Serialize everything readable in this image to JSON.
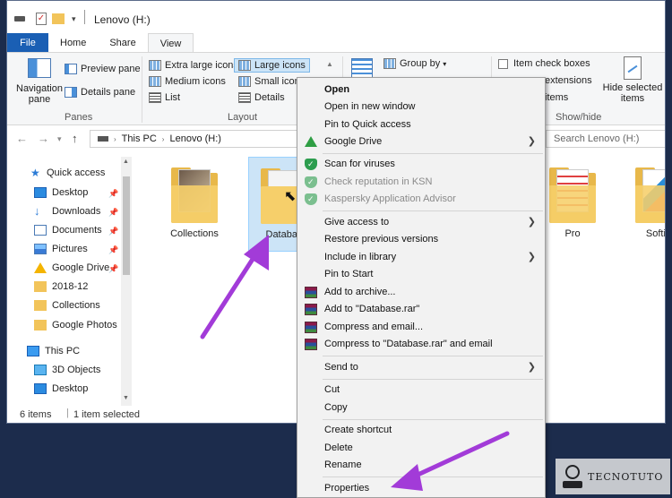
{
  "window": {
    "title": "Lenovo (H:)"
  },
  "ribbon": {
    "tabs": [
      "File",
      "Home",
      "Share",
      "View"
    ],
    "active_tab": "View",
    "panes": {
      "navigation_pane": "Navigation pane",
      "preview_pane": "Preview pane",
      "details_pane": "Details pane",
      "group_label": "Panes"
    },
    "layout": {
      "extra_large": "Extra large icons",
      "large": "Large icons",
      "medium": "Medium icons",
      "small": "Small icons",
      "list": "List",
      "details": "Details",
      "group_label": "Layout"
    },
    "current_view": {
      "group_by": "Group by"
    },
    "show_hide": {
      "item_check_boxes": "Item check boxes",
      "extensions": "extensions",
      "items": "items",
      "hide_selected": "Hide selected items",
      "group_label": "Show/hide"
    }
  },
  "address": {
    "path": [
      "This PC",
      "Lenovo (H:)"
    ],
    "search_placeholder": "Search Lenovo (H:)"
  },
  "nav_pane": {
    "items": [
      {
        "label": "Quick access",
        "icon": "star-icon",
        "pinned": false
      },
      {
        "label": "Desktop",
        "icon": "desktop-icon",
        "pinned": true
      },
      {
        "label": "Downloads",
        "icon": "download-icon",
        "pinned": true
      },
      {
        "label": "Documents",
        "icon": "documents-icon",
        "pinned": true
      },
      {
        "label": "Pictures",
        "icon": "pictures-icon",
        "pinned": true
      },
      {
        "label": "Google Drive",
        "icon": "google-drive-icon",
        "pinned": true
      },
      {
        "label": "2018-12",
        "icon": "folder-icon",
        "pinned": false
      },
      {
        "label": "Collections",
        "icon": "folder-icon",
        "pinned": false
      },
      {
        "label": "Google Photos",
        "icon": "folder-icon",
        "pinned": false
      },
      {
        "label": "This PC",
        "icon": "computer-icon",
        "pinned": false
      },
      {
        "label": "3D Objects",
        "icon": "cube-icon",
        "pinned": false
      },
      {
        "label": "Desktop",
        "icon": "desktop-icon",
        "pinned": false
      }
    ]
  },
  "files": [
    {
      "name": "Collections"
    },
    {
      "name": "Databas"
    },
    {
      "name": "Pro"
    },
    {
      "name": "Softie"
    }
  ],
  "status": {
    "count": "6 items",
    "selected": "1 item selected"
  },
  "context_menu": {
    "items": [
      {
        "label": "Open",
        "bold": true
      },
      {
        "label": "Open in new window"
      },
      {
        "label": "Pin to Quick access"
      },
      {
        "label": "Google Drive",
        "submenu": true,
        "icon": "google-drive-icon"
      },
      {
        "label": "Scan for viruses",
        "icon": "kaspersky-shield-icon"
      },
      {
        "label": "Check reputation in KSN",
        "icon": "kaspersky-shield-icon",
        "disabled": true
      },
      {
        "label": "Kaspersky Application Advisor",
        "icon": "kaspersky-shield-icon",
        "disabled": true
      },
      {
        "label": "Give access to",
        "submenu": true
      },
      {
        "label": "Restore previous versions"
      },
      {
        "label": "Include in library",
        "submenu": true
      },
      {
        "label": "Pin to Start"
      },
      {
        "label": "Add to archive...",
        "icon": "winrar-icon"
      },
      {
        "label": "Add to \"Database.rar\"",
        "icon": "winrar-icon"
      },
      {
        "label": "Compress and email...",
        "icon": "winrar-icon"
      },
      {
        "label": "Compress to \"Database.rar\" and email",
        "icon": "winrar-icon"
      },
      {
        "label": "Send to",
        "submenu": true
      },
      {
        "label": "Cut"
      },
      {
        "label": "Copy"
      },
      {
        "label": "Create shortcut"
      },
      {
        "label": "Delete"
      },
      {
        "label": "Rename"
      },
      {
        "label": "Properties"
      }
    ]
  },
  "watermark": {
    "text": "TECNOTUTO"
  },
  "colors": {
    "accent": "#1a5fb4",
    "selection": "#cce4f7",
    "annotation_arrow": "#a23bd8"
  }
}
